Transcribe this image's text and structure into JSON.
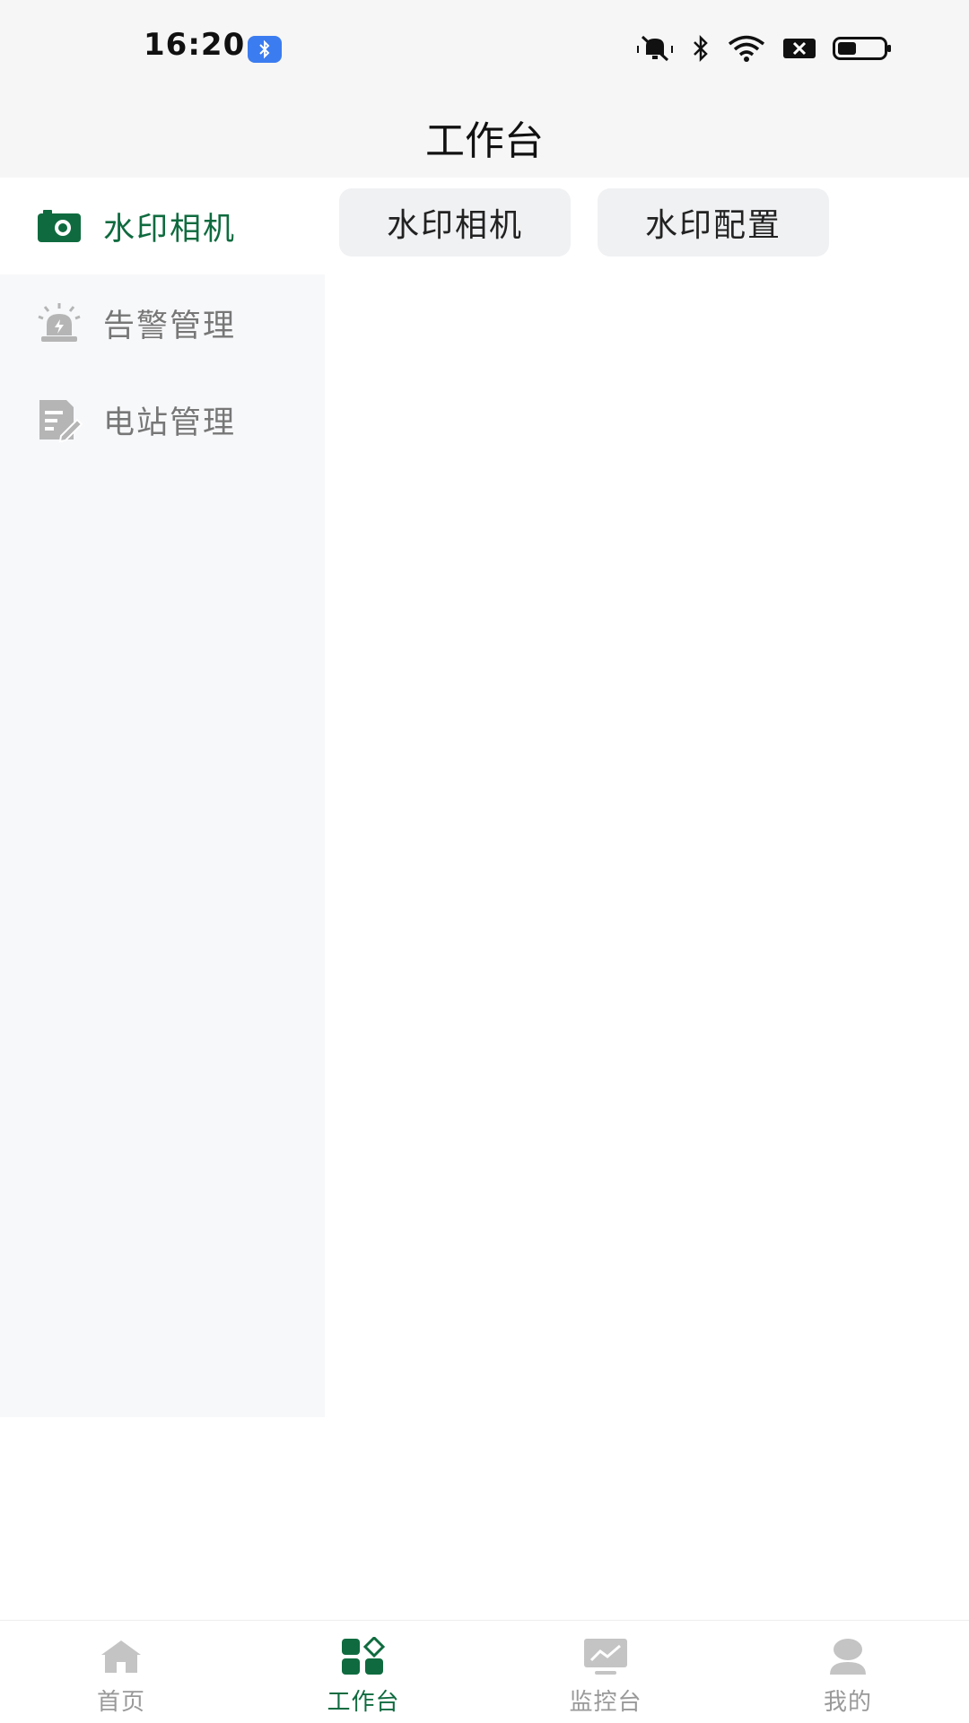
{
  "status_bar": {
    "time": "16:20"
  },
  "header": {
    "title": "工作台"
  },
  "sidebar": {
    "items": [
      {
        "label": "水印相机",
        "icon": "camera-icon",
        "active": true
      },
      {
        "label": "告警管理",
        "icon": "alarm-icon",
        "active": false
      },
      {
        "label": "电站管理",
        "icon": "document-edit-icon",
        "active": false
      }
    ]
  },
  "content": {
    "chips": [
      {
        "label": "水印相机"
      },
      {
        "label": "水印配置"
      }
    ]
  },
  "tabbar": {
    "items": [
      {
        "label": "首页",
        "icon": "home-icon",
        "active": false
      },
      {
        "label": "工作台",
        "icon": "workbench-icon",
        "active": true
      },
      {
        "label": "监控台",
        "icon": "monitor-icon",
        "active": false
      },
      {
        "label": "我的",
        "icon": "user-icon",
        "active": false
      }
    ]
  },
  "colors": {
    "accent": "#0f6b3f",
    "inactive": "#999999",
    "sidebar_bg": "#f7f8fa",
    "chip_bg": "#f0f1f3"
  }
}
